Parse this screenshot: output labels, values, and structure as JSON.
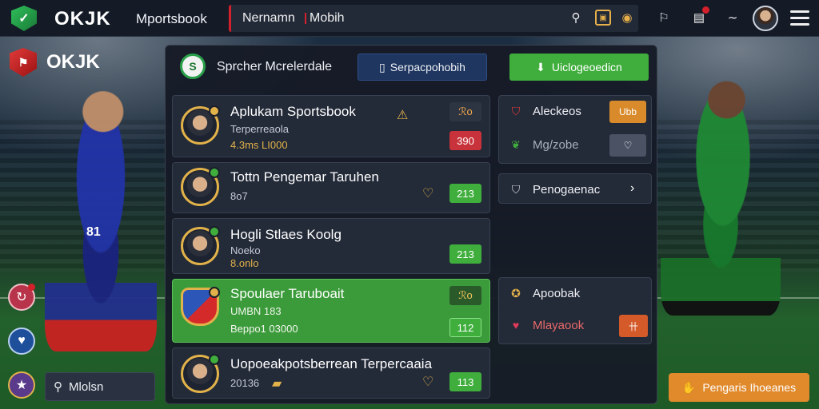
{
  "topbar": {
    "brand": "OKJK",
    "nav_link": "Mportsbook",
    "search_name": "Nernamn",
    "search_mobile": "Mobih"
  },
  "side": {
    "brand": "OKJK",
    "player_number": "81",
    "search_label": "Mlolsn"
  },
  "panel": {
    "header_title": "Sprcher Mcrelerdale",
    "blue_button": "Serpacpohobih",
    "green_button": "Uiclogeoedicn",
    "cards": [
      {
        "title": "Aplukam Sportsbook",
        "sub": "Terperreaola",
        "sub2": "4.3ms LI000",
        "odds": "390",
        "odds_alt": "ℛo"
      },
      {
        "title": "Tottn Pengemar Taruhen",
        "sub": "8o7",
        "odds": "213"
      },
      {
        "title": "Hogli Stlaes Koolg",
        "sub": "Noeko",
        "sub2": "8.onlo",
        "odds": "213"
      },
      {
        "title": "Spoulaer Taruboait",
        "sub": "UMBN 183",
        "sub2": "Beppo1 03000",
        "odds": "112",
        "odds_alt": "ℛo"
      },
      {
        "title": "Uopoeakpotsberrean Terpercaaia",
        "sub": "20136",
        "odds": "113"
      }
    ],
    "right": {
      "alerts": "Aleckeos",
      "alerts_btn": "Ubb",
      "mobile": "Mg/zobe",
      "pengaturan": "Penogaenac",
      "apoobak": "Apoobak",
      "milayaook": "Mlayaook"
    }
  },
  "cta_label": "Pengaris Ihoeanes",
  "colors": {
    "accent_green": "#3fae3c",
    "accent_red": "#c8323a",
    "accent_gold": "#e2b24a",
    "cta_orange": "#e08a2c"
  }
}
